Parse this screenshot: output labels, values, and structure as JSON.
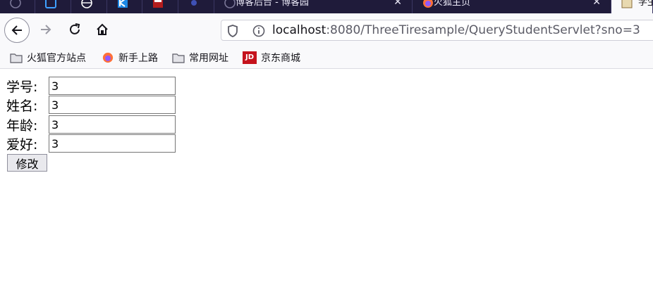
{
  "tabs": [
    {
      "title": "",
      "icon": "github-icon"
    },
    {
      "title": "",
      "icon": "app-icon"
    },
    {
      "title": "",
      "icon": "globe-icon"
    },
    {
      "title": "",
      "icon": "kanban-icon"
    },
    {
      "title": "",
      "icon": "site-icon"
    },
    {
      "title": "",
      "icon": "pin-icon"
    },
    {
      "title": "博客后台 - 博客园",
      "icon": "github-icon"
    },
    {
      "title": "火狐主页",
      "icon": "firefox-icon"
    },
    {
      "title": "学生",
      "icon": "page-icon"
    }
  ],
  "address": {
    "host": "localhost",
    "rest": ":8080/ThreeTiresample/QueryStudentServlet?sno=3"
  },
  "bookmarks": [
    {
      "label": "火狐官方站点",
      "icon": "folder-icon"
    },
    {
      "label": "新手上路",
      "icon": "firefox-icon"
    },
    {
      "label": "常用网址",
      "icon": "folder-icon"
    },
    {
      "label": "京东商城",
      "icon": "jd-icon",
      "icon_text": "JD"
    }
  ],
  "form": {
    "fields": [
      {
        "label": "学号:",
        "value": "3"
      },
      {
        "label": "姓名:",
        "value": "3"
      },
      {
        "label": "年龄:",
        "value": "3"
      },
      {
        "label": "爱好:",
        "value": "3"
      }
    ],
    "submit_label": "修改"
  },
  "colors": {
    "tabbar": "#1f1b3a",
    "toolbar": "#f9f9fb",
    "jd_red": "#c5121c"
  }
}
